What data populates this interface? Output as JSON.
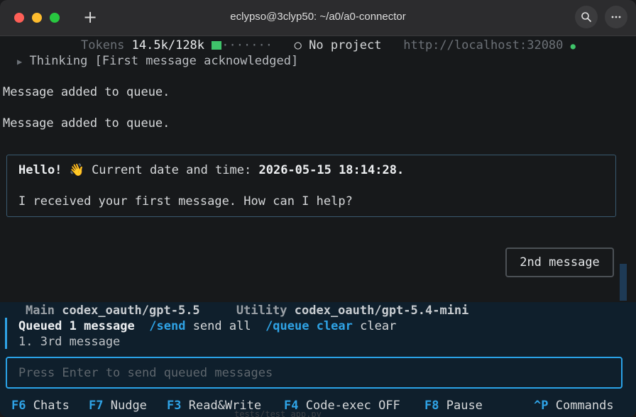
{
  "window": {
    "title": "eclypso@3clyp50: ~/a0/a0-connector",
    "new_tab_icon": "plus-icon",
    "search_icon": "search-icon",
    "more_icon": "ellipsis-icon"
  },
  "status": {
    "tokens_label": "Tokens",
    "tokens_value": "14.5k/128k",
    "tokens_fraction": 0.113,
    "progress_dots": "·······",
    "project_icon": "○",
    "project": "No project",
    "url": "http://localhost:32080",
    "connected_dot": "●"
  },
  "thinking": {
    "arrow": "▶",
    "text": "Thinking [First message acknowledged]"
  },
  "log": [
    "Message added to queue.",
    "Message added to queue."
  ],
  "assistant_message": {
    "greeting": "Hello! 👋",
    "datetime_label": "Current date and time:",
    "datetime": "2026-05-15 18:14:28.",
    "body": "I received your first message. How can I help?"
  },
  "user_message": "2nd message",
  "models": {
    "main_label": "Main",
    "main_value": "codex_oauth/gpt-5.5",
    "utility_label": "Utility",
    "utility_value": "codex_oauth/gpt-5.4-mini"
  },
  "queue": {
    "title": "Queued 1 message",
    "send_cmd": "/send",
    "send_desc": "send all",
    "clear_cmd": "/queue clear",
    "clear_desc": "clear",
    "items": [
      "1. 3rd message"
    ]
  },
  "input": {
    "placeholder": "Press Enter to send queued messages"
  },
  "function_keys": [
    {
      "key": "F6",
      "label": "Chats"
    },
    {
      "key": "F7",
      "label": "Nudge"
    },
    {
      "key": "F3",
      "label": "Read&Write"
    },
    {
      "key": "F4",
      "label": "Code-exec OFF"
    },
    {
      "key": "F8",
      "label": "Pause"
    },
    {
      "key": "^P",
      "label": "Commands"
    }
  ],
  "ghost_text": "tests/test_app.py",
  "colors": {
    "accent": "#2fa3e6",
    "green": "#3fc46a",
    "background": "#17191b",
    "panel": "#0f1f2c"
  }
}
